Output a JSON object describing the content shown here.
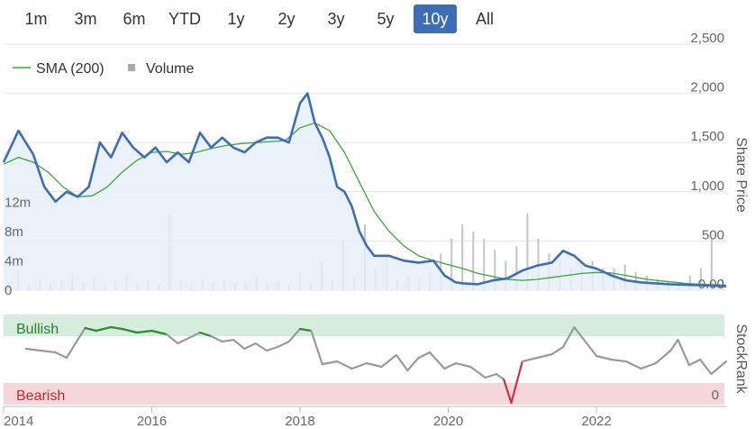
{
  "range_selector": {
    "buttons": [
      "1m",
      "3m",
      "6m",
      "YTD",
      "1y",
      "2y",
      "3y",
      "5y",
      "10y",
      "All"
    ],
    "active": "10y"
  },
  "legend": {
    "sma_label": "SMA (200)",
    "volume_label": "Volume"
  },
  "colors": {
    "price_line": "#3d6eb5",
    "price_fill": "#e8eef7",
    "sma_line": "#3aa63a",
    "volume_bar": "#c4c4c4",
    "bullish_band": "#d6ecdc",
    "bearish_band": "#f6d7d9",
    "stockrank_line": "#9a9a9a",
    "stockrank_bullish": "#2e8b2e",
    "stockrank_bearish": "#d0303d",
    "active_button": "#3d6eb5"
  },
  "chart_data": [
    {
      "type": "line",
      "yaxis_title": "Share Price",
      "yaxis_ticks": [
        "2,500",
        "2,000",
        "1,500",
        "1,000",
        "500",
        "0.00"
      ],
      "ylim": [
        0,
        2500
      ],
      "volume_axis_ticks": [
        "12m",
        "8m",
        "4m",
        "0"
      ],
      "volume_ylim": [
        0,
        16
      ],
      "xaxis_ticks": [
        "2014",
        "2016",
        "2018",
        "2020",
        "2022"
      ],
      "xlim": [
        2014.0,
        2023.75
      ],
      "grid": true,
      "legend_position": "top-left",
      "series": [
        {
          "name": "",
          "x": [
            2014.0,
            2014.2,
            2014.4,
            2014.55,
            2014.7,
            2014.85,
            2015.0,
            2015.15,
            2015.3,
            2015.45,
            2015.6,
            2015.75,
            2015.9,
            2016.05,
            2016.2,
            2016.35,
            2016.5,
            2016.65,
            2016.8,
            2016.95,
            2017.1,
            2017.25,
            2017.4,
            2017.55,
            2017.7,
            2017.85,
            2018.0,
            2018.1,
            2018.2,
            2018.3,
            2018.4,
            2018.5,
            2018.6,
            2018.7,
            2018.8,
            2018.9,
            2019.0,
            2019.2,
            2019.4,
            2019.6,
            2019.8,
            2019.95,
            2020.1,
            2020.2,
            2020.4,
            2020.6,
            2020.8,
            2021.0,
            2021.2,
            2021.4,
            2021.55,
            2021.7,
            2021.85,
            2022.0,
            2022.2,
            2022.4,
            2022.6,
            2022.8,
            2023.0,
            2023.2,
            2023.4,
            2023.6,
            2023.75
          ],
          "values": [
            1300,
            1620,
            1380,
            1050,
            900,
            1000,
            950,
            1050,
            1500,
            1350,
            1600,
            1450,
            1350,
            1450,
            1300,
            1400,
            1300,
            1600,
            1450,
            1550,
            1450,
            1400,
            1500,
            1550,
            1550,
            1500,
            1900,
            2000,
            1700,
            1550,
            1350,
            1050,
            1000,
            850,
            600,
            450,
            350,
            350,
            300,
            280,
            300,
            150,
            80,
            70,
            60,
            100,
            120,
            200,
            250,
            280,
            400,
            350,
            250,
            220,
            150,
            100,
            80,
            70,
            60,
            55,
            50,
            45,
            40
          ]
        },
        {
          "name": "SMA (200)",
          "x": [
            2014.0,
            2014.2,
            2014.4,
            2014.6,
            2014.8,
            2015.0,
            2015.2,
            2015.4,
            2015.6,
            2015.8,
            2016.0,
            2016.2,
            2016.4,
            2016.6,
            2016.8,
            2017.0,
            2017.2,
            2017.4,
            2017.6,
            2017.8,
            2018.0,
            2018.2,
            2018.4,
            2018.6,
            2018.8,
            2019.0,
            2019.2,
            2019.4,
            2019.6,
            2019.8,
            2020.0,
            2020.2,
            2020.4,
            2020.6,
            2020.8,
            2021.0,
            2021.2,
            2021.4,
            2021.6,
            2021.8,
            2022.0,
            2022.2,
            2022.4,
            2022.6,
            2022.8,
            2023.0,
            2023.2,
            2023.4,
            2023.6,
            2023.75
          ],
          "values": [
            1280,
            1350,
            1300,
            1200,
            1050,
            950,
            960,
            1050,
            1200,
            1320,
            1400,
            1410,
            1380,
            1400,
            1440,
            1470,
            1490,
            1500,
            1510,
            1520,
            1650,
            1700,
            1620,
            1400,
            1100,
            800,
            600,
            450,
            350,
            300,
            260,
            220,
            170,
            140,
            110,
            100,
            110,
            130,
            150,
            170,
            180,
            175,
            150,
            120,
            100,
            85,
            70,
            60,
            55,
            50
          ]
        }
      ],
      "volume_m": [
        1.2,
        2.8,
        1.0,
        1.6,
        0.9,
        1.4,
        2.2,
        1.1,
        1.8,
        0.8,
        1.3,
        2.0,
        1.0,
        1.5,
        0.9,
        10.4,
        1.2,
        0.8,
        1.6,
        1.0,
        1.4,
        0.9,
        1.1,
        1.8,
        1.0,
        1.3,
        0.8,
        2.4,
        1.1,
        4.0,
        1.5,
        7.0,
        2.0,
        9.0,
        3.0,
        4.5,
        1.5,
        2.0,
        1.8,
        2.5,
        5.0,
        7.0,
        9.0,
        8.0,
        7.0,
        5.5,
        4.0,
        6.0,
        10.5,
        7.0,
        5.0,
        4.0,
        3.0,
        3.5,
        4.0,
        3.0,
        3.0,
        3.5,
        2.5,
        2.0,
        1.5,
        1.2,
        0.8,
        2.0,
        3.0,
        7.0,
        1.5
      ]
    },
    {
      "type": "line",
      "yaxis_title": "StockRank",
      "yaxis_ticks": [
        "0"
      ],
      "ylim": [
        0,
        100
      ],
      "band_labels": {
        "bullish": "Bullish",
        "bearish": "Bearish"
      },
      "series": [
        {
          "name": "",
          "x": [
            2014.3,
            2014.5,
            2014.7,
            2014.85,
            2015.0,
            2015.1,
            2015.25,
            2015.45,
            2015.6,
            2015.8,
            2016.0,
            2016.2,
            2016.35,
            2016.5,
            2016.65,
            2016.8,
            2016.95,
            2017.1,
            2017.25,
            2017.4,
            2017.55,
            2017.7,
            2017.85,
            2018.0,
            2018.15,
            2018.3,
            2018.5,
            2018.7,
            2018.9,
            2019.1,
            2019.3,
            2019.45,
            2019.6,
            2019.75,
            2019.95,
            2020.1,
            2020.3,
            2020.5,
            2020.65,
            2020.75,
            2020.85,
            2021.0,
            2021.2,
            2021.4,
            2021.55,
            2021.7,
            2021.85,
            2022.0,
            2022.2,
            2022.4,
            2022.6,
            2022.8,
            2023.0,
            2023.1,
            2023.25,
            2023.4,
            2023.55,
            2023.75
          ],
          "values": [
            62,
            60,
            58,
            52,
            72,
            85,
            82,
            86,
            84,
            80,
            82,
            78,
            68,
            74,
            80,
            76,
            70,
            72,
            62,
            68,
            60,
            64,
            70,
            84,
            82,
            45,
            48,
            40,
            46,
            42,
            55,
            38,
            52,
            58,
            40,
            46,
            42,
            30,
            34,
            28,
            2,
            48,
            52,
            56,
            64,
            86,
            70,
            54,
            50,
            48,
            40,
            46,
            60,
            72,
            44,
            50,
            34,
            48
          ],
          "bullish_threshold": 75,
          "bearish_threshold": 8
        }
      ]
    }
  ]
}
